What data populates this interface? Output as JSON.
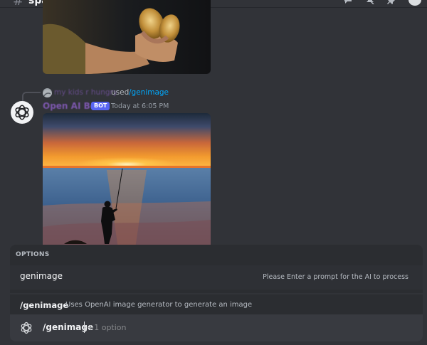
{
  "top_bar": {
    "channel_name": "spam",
    "icons": [
      "threads-icon",
      "mute-icon",
      "pin-icon",
      "member-list-icon"
    ]
  },
  "reply": {
    "user": "my kids r hungry",
    "used_text": "used",
    "command": "/genimage"
  },
  "message": {
    "author": "Open AI Bot",
    "badge": "BOT",
    "timestamp": "Today at 6:05 PM"
  },
  "options_panel": {
    "header": "OPTIONS",
    "option": {
      "name": "genimage",
      "description": "Please Enter a prompt for the AI to process"
    }
  },
  "command_info": {
    "name": "/genimage",
    "description": "Uses OpenAI image generator to generate an image"
  },
  "input": {
    "command": "/genimage",
    "hint": "+1 option"
  },
  "colors": {
    "background": "#313338",
    "panel": "#2b2d31",
    "input": "#383a40",
    "blurple": "#5865f2",
    "link": "#00a8fc"
  }
}
